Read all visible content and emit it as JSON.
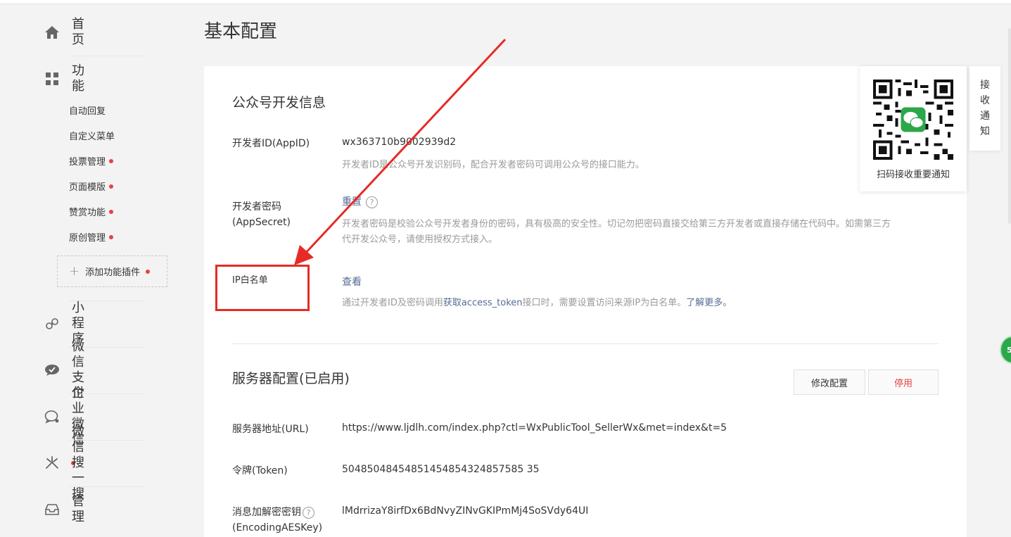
{
  "sidebar": {
    "home": "首页",
    "features": "功能",
    "sub_items": [
      {
        "label": "自动回复",
        "dot": false
      },
      {
        "label": "自定义菜单",
        "dot": false
      },
      {
        "label": "投票管理",
        "dot": true
      },
      {
        "label": "页面模版",
        "dot": true
      },
      {
        "label": "赞赏功能",
        "dot": true
      },
      {
        "label": "原创管理",
        "dot": true
      }
    ],
    "add_plugin": "添加功能插件",
    "mini_program": "小程序",
    "wechat_pay": "微信支付",
    "work_wechat": "企业微信",
    "wechat_search": "微信搜一搜",
    "manage": "管理"
  },
  "page_title": "基本配置",
  "dev_info": {
    "title": "公众号开发信息",
    "appid_label": "开发者ID(AppID)",
    "appid_value": "wx363710b9002939d2",
    "appid_desc": "开发者ID是公众号开发识别码，配合开发者密码可调用公众号的接口能力。",
    "secret_label_1": "开发者密码",
    "secret_label_2": "(AppSecret)",
    "secret_action": "重置",
    "secret_help": "?",
    "secret_desc_1": "开发者密码是校验公众号开发者身份的密码，具有极高的安全性。切记勿把密码直接交给第三方开发者或直接存储在代码中。如需第三方",
    "secret_desc_2": "代开发公众号，请使用授权方式接入。",
    "ip_label": "IP白名单",
    "ip_action": "查看",
    "ip_desc_pre": "通过开发者ID及密码调用",
    "ip_desc_link": "获取access_token",
    "ip_desc_post": "接口时，需要设置访问来源IP为白名单。",
    "ip_desc_more": "了解更多。"
  },
  "server": {
    "title": "服务器配置(已启用)",
    "modify_button": "修改配置",
    "disable_button": "停用",
    "url_label": "服务器地址(URL)",
    "url_value": "https://www.ljdlh.com/index.php?ctl=WxPublicTool_SellerWx&met=index&t=5",
    "token_label": "令牌(Token)",
    "token_value": "50485048454851454854324857585 35",
    "aes_label_1": "消息加解密密钥",
    "aes_label_2": "(EncodingAESKey)",
    "aes_help": "?",
    "aes_value": "lMdrrizaY8irfDx6BdNvyZINvGKIPmMj4SoSVdy64UI"
  },
  "qr": {
    "caption": "扫码接收重要通知"
  },
  "notice_tab": [
    "接",
    "收",
    "通",
    "知"
  ],
  "float_badge": "53",
  "colors": {
    "accent_link": "#576b95",
    "danger": "#e64340",
    "annotation_red": "#e62b26",
    "wechat_green": "#2ca74a"
  }
}
